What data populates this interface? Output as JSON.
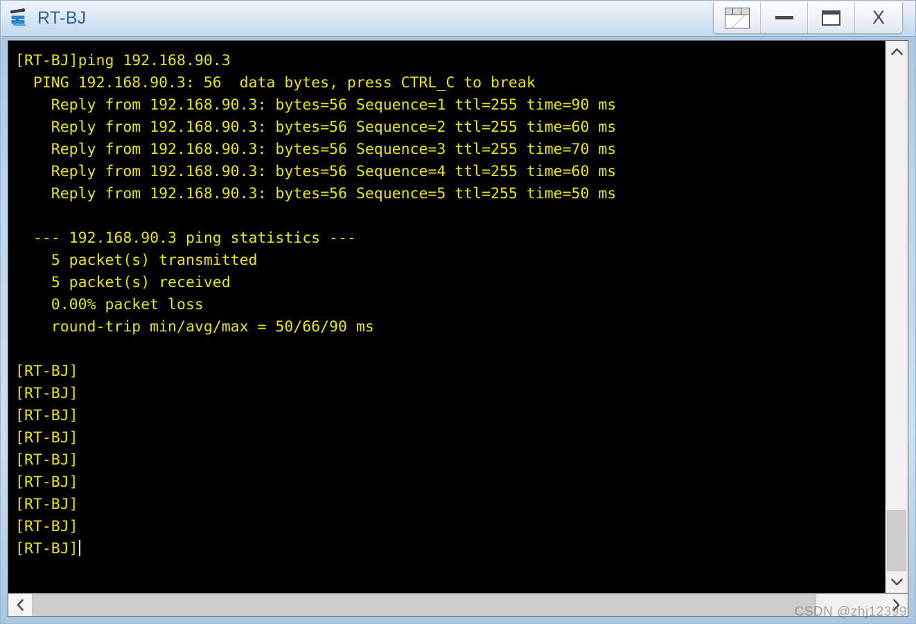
{
  "window": {
    "title": "RT-BJ",
    "icon": "router-device-icon",
    "accent_color": "#2e6096",
    "frame_color": "#bdd4e9",
    "terminal_bg": "#000000",
    "terminal_fg": "#e8e800"
  },
  "titlebar_buttons": [
    {
      "name": "restore-multi-button",
      "label": "",
      "tooltip": "Restore All"
    },
    {
      "name": "minimize-button",
      "label": "–",
      "tooltip": "Minimize"
    },
    {
      "name": "maximize-button",
      "label": "",
      "tooltip": "Maximize"
    },
    {
      "name": "close-button",
      "label": "X",
      "tooltip": "Close"
    }
  ],
  "terminal": {
    "lines": [
      "[RT-BJ]ping 192.168.90.3",
      "  PING 192.168.90.3: 56  data bytes, press CTRL_C to break",
      "    Reply from 192.168.90.3: bytes=56 Sequence=1 ttl=255 time=90 ms",
      "    Reply from 192.168.90.3: bytes=56 Sequence=2 ttl=255 time=60 ms",
      "    Reply from 192.168.90.3: bytes=56 Sequence=3 ttl=255 time=70 ms",
      "    Reply from 192.168.90.3: bytes=56 Sequence=4 ttl=255 time=60 ms",
      "    Reply from 192.168.90.3: bytes=56 Sequence=5 ttl=255 time=50 ms",
      "",
      "  --- 192.168.90.3 ping statistics ---",
      "    5 packet(s) transmitted",
      "    5 packet(s) received",
      "    0.00% packet loss",
      "    round-trip min/avg/max = 50/66/90 ms",
      "",
      "[RT-BJ]",
      "[RT-BJ]",
      "[RT-BJ]",
      "[RT-BJ]",
      "[RT-BJ]",
      "[RT-BJ]",
      "[RT-BJ]",
      "[RT-BJ]"
    ],
    "prompt_line": "[RT-BJ]",
    "cursor_visible": true,
    "command_entered": "ping 192.168.90.3",
    "target_host": "192.168.90.3",
    "packet_size": "56",
    "transmitted": "5",
    "received": "5",
    "packet_loss": "0.00%",
    "rtt_min": "50",
    "rtt_avg": "66",
    "rtt_max": "90",
    "rtt_unit": "ms"
  },
  "scrollbars": {
    "vertical": {
      "up_icon": "chevron-up-icon",
      "down_icon": "chevron-down-icon",
      "thumb_top_percent": 88,
      "thumb_height_percent": 12
    },
    "horizontal": {
      "left_icon": "chevron-left-icon",
      "right_icon": "chevron-right-icon",
      "thumb_width_percent": 92
    }
  },
  "watermark": {
    "text": "CSDN @zhj12399"
  }
}
